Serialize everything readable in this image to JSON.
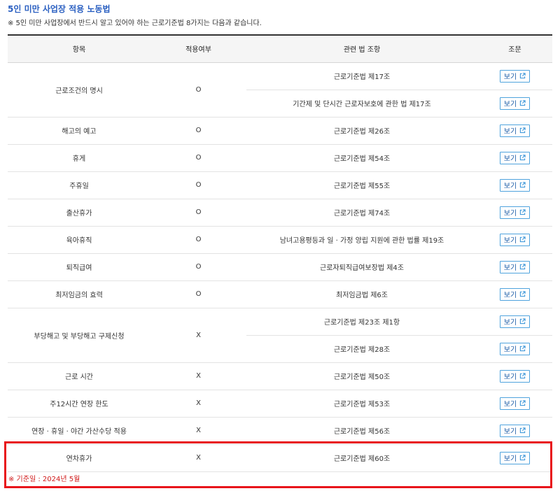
{
  "header": {
    "title": "5인 미만 사업장 적용 노동법",
    "subtitle": "※ 5인 미만 사업장에서 반드시 알고 있어야 하는 근로기준법 8가지는 다음과 같습니다."
  },
  "table": {
    "columns": [
      "항목",
      "적용여부",
      "관련 법 조항",
      "조문"
    ],
    "button_label": "보기",
    "rows": [
      {
        "item": "근로조건의 명시",
        "applicable": "O",
        "laws": [
          "근로기준법 제17조",
          "기간제 및 단시간 근로자보호에 관한 법 제17조"
        ]
      },
      {
        "item": "해고의 예고",
        "applicable": "O",
        "laws": [
          "근로기준법 제26조"
        ]
      },
      {
        "item": "휴게",
        "applicable": "O",
        "laws": [
          "근로기준법 제54조"
        ]
      },
      {
        "item": "주휴일",
        "applicable": "O",
        "laws": [
          "근로기준법 제55조"
        ]
      },
      {
        "item": "출산휴가",
        "applicable": "O",
        "laws": [
          "근로기준법 제74조"
        ]
      },
      {
        "item": "육아휴직",
        "applicable": "O",
        "laws": [
          "남녀고용평등과 일 · 가정 양립 지원에 관한 법률 제19조"
        ]
      },
      {
        "item": "퇴직급여",
        "applicable": "O",
        "laws": [
          "근로자퇴직급여보장법 제4조"
        ]
      },
      {
        "item": "최저임금의 효력",
        "applicable": "O",
        "laws": [
          "최저임금법 제6조"
        ]
      },
      {
        "item": "부당해고 및 부당해고 구제신청",
        "applicable": "X",
        "laws": [
          "근로기준법 제23조 제1항",
          "근로기준법 제28조"
        ]
      },
      {
        "item": "근로 시간",
        "applicable": "X",
        "laws": [
          "근로기준법 제50조"
        ]
      },
      {
        "item": "주12시간 연장 한도",
        "applicable": "X",
        "laws": [
          "근로기준법 제53조"
        ]
      },
      {
        "item": "연장 · 휴일 · 야간 가산수당 적용",
        "applicable": "X",
        "laws": [
          "근로기준법 제56조"
        ]
      },
      {
        "item": "연차휴가",
        "applicable": "X",
        "laws": [
          "근로기준법 제60조"
        ]
      }
    ]
  },
  "note": "※ 기준일 : 2024년 5월",
  "colors": {
    "title": "#2a5fc1",
    "button_border": "#4fa3dd",
    "highlight": "#e8151b",
    "note": "#d01919"
  },
  "icons": {
    "view_button": "external-link-icon"
  }
}
